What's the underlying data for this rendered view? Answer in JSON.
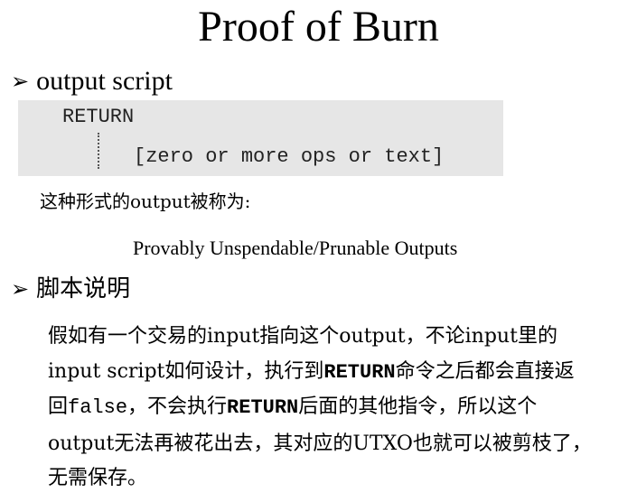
{
  "title": "Proof of Burn",
  "bullet1": {
    "marker": "➢",
    "label": "output script"
  },
  "code": {
    "line1": "RETURN",
    "line2": "[zero or more ops or text]"
  },
  "description": "这种形式的output被称为:",
  "outputs_name": "Provably Unspendable/Prunable Outputs",
  "bullet2": {
    "marker": "➢",
    "label": "脚本说明"
  },
  "body": {
    "l1": "假如有一个交易的input指向这个output，不论input里的",
    "l2a": "input script如何设计，执行到",
    "l2b": "RETURN",
    "l2c": "命令之后都会直接返",
    "l3a": "回",
    "l3b": "false",
    "l3c": "，不会执行",
    "l3d": "RETURN",
    "l3e": "后面的其他指令，所以这个",
    "l4": "output无法再被花出去，其对应的UTXO也就可以被剪枝了，",
    "l5": "无需保存。"
  }
}
